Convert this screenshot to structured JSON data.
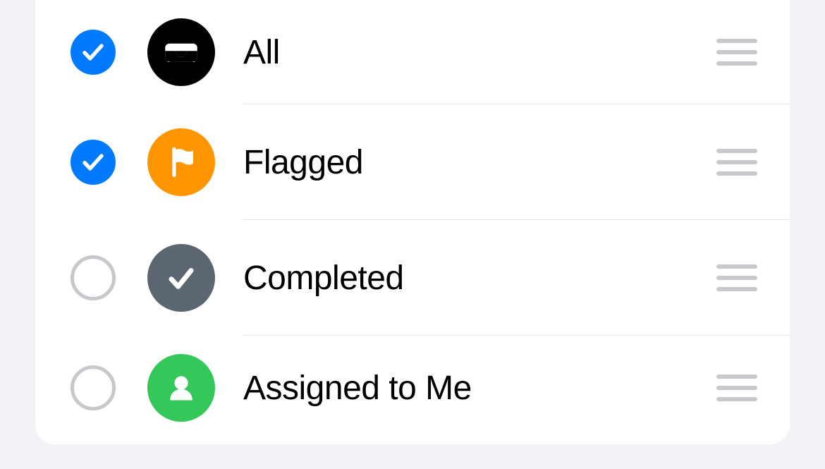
{
  "items": [
    {
      "id": "all",
      "label": "All",
      "checked": true,
      "icon": "tray",
      "icon_color": "#000000"
    },
    {
      "id": "flagged",
      "label": "Flagged",
      "checked": true,
      "icon": "flag",
      "icon_color": "#ff9500"
    },
    {
      "id": "completed",
      "label": "Completed",
      "checked": false,
      "icon": "check",
      "icon_color": "#5b6670"
    },
    {
      "id": "assigned",
      "label": "Assigned to Me",
      "checked": false,
      "icon": "person",
      "icon_color": "#34c759"
    }
  ],
  "colors": {
    "accent_blue": "#007aff",
    "page_bg": "#f2f2f7",
    "divider": "#e5e5ea",
    "handle": "#c7c7cc",
    "checkbox_ring": "#c7c7cc"
  }
}
